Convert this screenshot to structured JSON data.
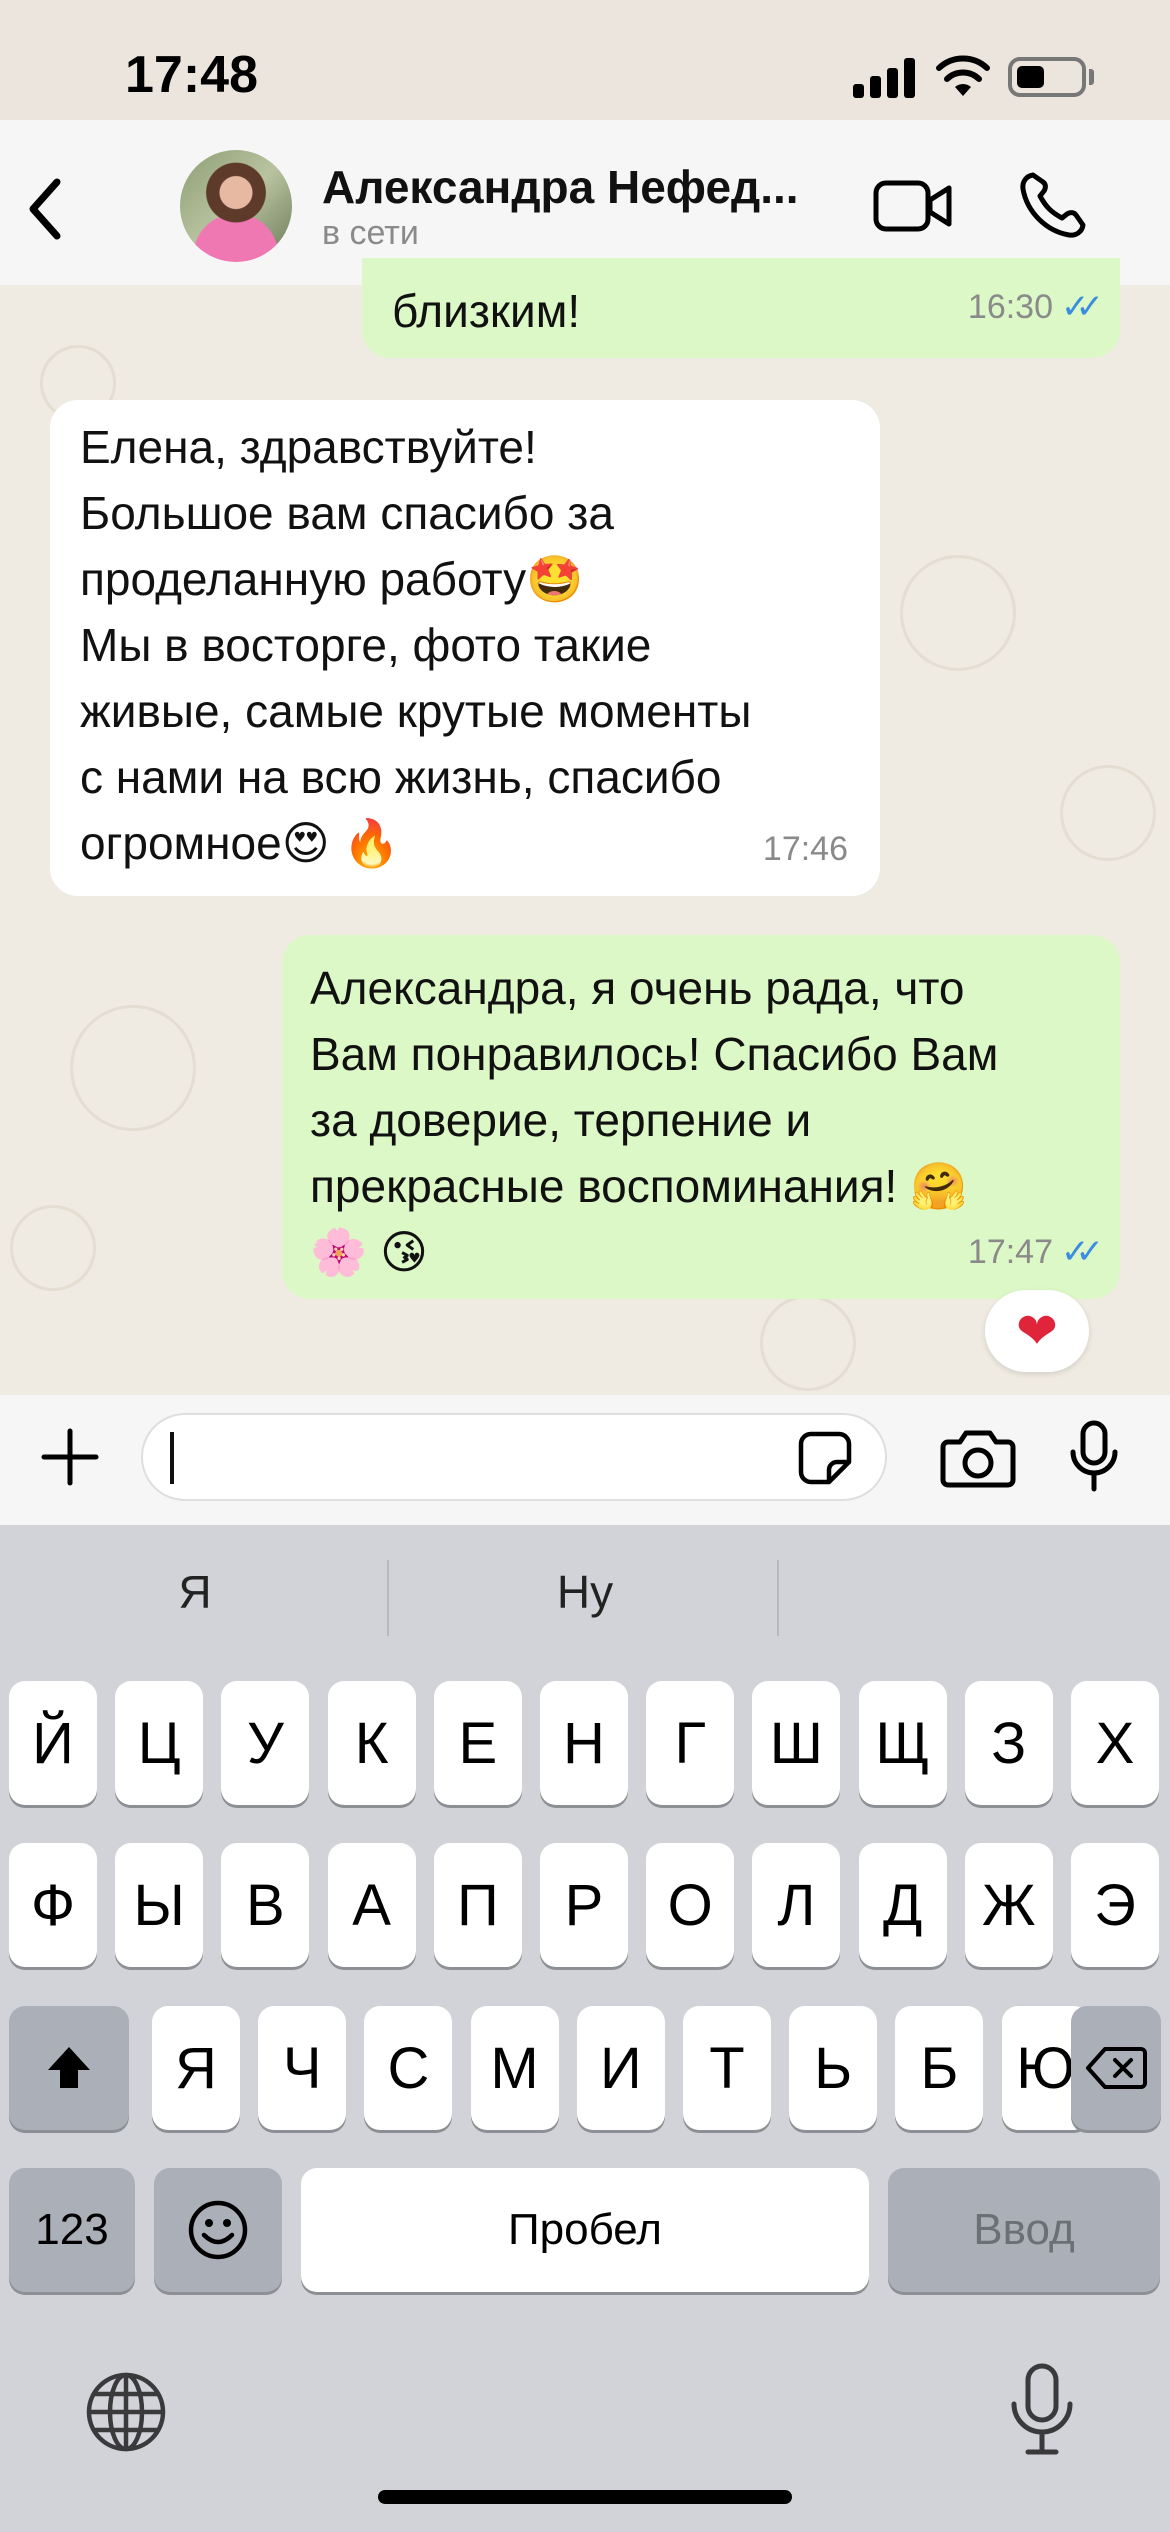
{
  "status_bar": {
    "time": "17:48"
  },
  "header": {
    "contact_name": "Александра Нефед...",
    "contact_status": "в сети"
  },
  "messages": [
    {
      "direction": "outgoing",
      "text": "близким!",
      "time": "16:30",
      "read": true
    },
    {
      "direction": "incoming",
      "text": "Елена, здравствуйте!\nБольшое вам спасибо за\nпроделанную работу🤩\nМы в восторге, фото такие\nживые, самые крутые моменты\nс нами на всю жизнь, спасибо\nогромное😍 🔥",
      "time": "17:46"
    },
    {
      "direction": "outgoing",
      "text": "Александра, я очень рада, что\nВам понравилось! Спасибо Вам\nза доверие, терпение и\nпрекрасные воспоминания! 🤗\n🌸 😘",
      "time": "17:47",
      "read": true,
      "reaction": "❤"
    }
  ],
  "composer": {
    "value": ""
  },
  "keyboard": {
    "suggestions": [
      "Я",
      "Ну",
      ""
    ],
    "row1": [
      "Й",
      "Ц",
      "У",
      "К",
      "Е",
      "Н",
      "Г",
      "Ш",
      "Щ",
      "З",
      "Х"
    ],
    "row2": [
      "Ф",
      "Ы",
      "В",
      "А",
      "П",
      "Р",
      "О",
      "Л",
      "Д",
      "Ж",
      "Э"
    ],
    "row3": [
      "Я",
      "Ч",
      "С",
      "М",
      "И",
      "Т",
      "Ь",
      "Б",
      "Ю"
    ],
    "numbers_key": "123",
    "space_key": "Пробел",
    "return_key": "Ввод"
  },
  "colors": {
    "outgoing_bubble": "#dcf8c6",
    "incoming_bubble": "#ffffff",
    "read_ticks": "#3b8de0",
    "chat_background": "#efeae2",
    "keyboard_background": "#d1d3d9"
  },
  "icons": {
    "back": "chevron-left-icon",
    "video": "video-camera-icon",
    "call": "phone-icon",
    "attach": "plus-icon",
    "sticker": "sticker-icon",
    "camera": "camera-icon",
    "voice": "microphone-icon",
    "keyboard_globe": "globe-icon",
    "dictation": "microphone-icon"
  }
}
